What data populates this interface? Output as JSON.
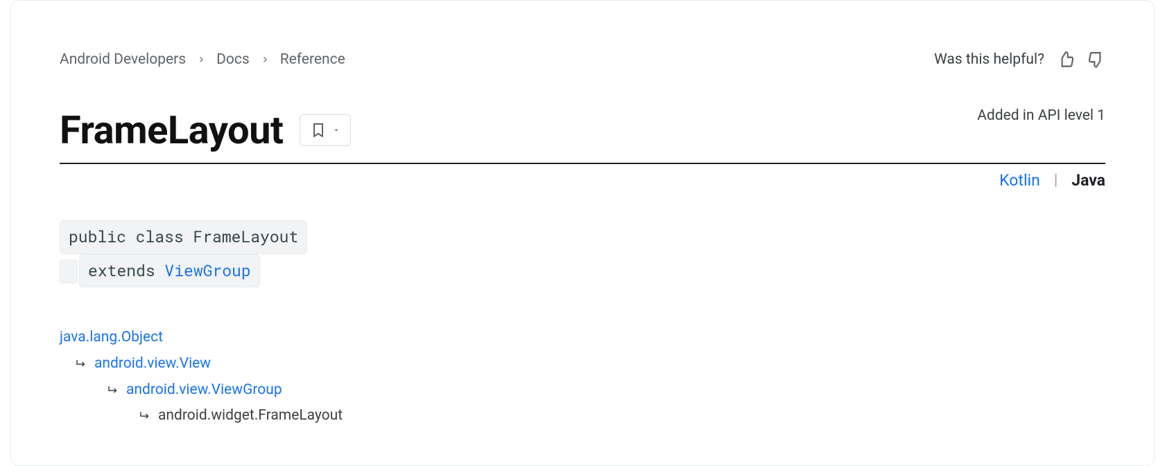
{
  "breadcrumb": {
    "items": [
      "Android Developers",
      "Docs",
      "Reference"
    ]
  },
  "feedback": {
    "prompt": "Was this helpful?"
  },
  "title": "FrameLayout",
  "added_in": "Added in API level 1",
  "languages": {
    "alt": "Kotlin",
    "active": "Java"
  },
  "signature": {
    "line1": "public class FrameLayout",
    "extends_kw": "extends ",
    "extends_link": "ViewGroup"
  },
  "hierarchy": {
    "r0": "java.lang.Object",
    "r1": "android.view.View",
    "r2": "android.view.ViewGroup",
    "r3": "android.widget.FrameLayout"
  }
}
